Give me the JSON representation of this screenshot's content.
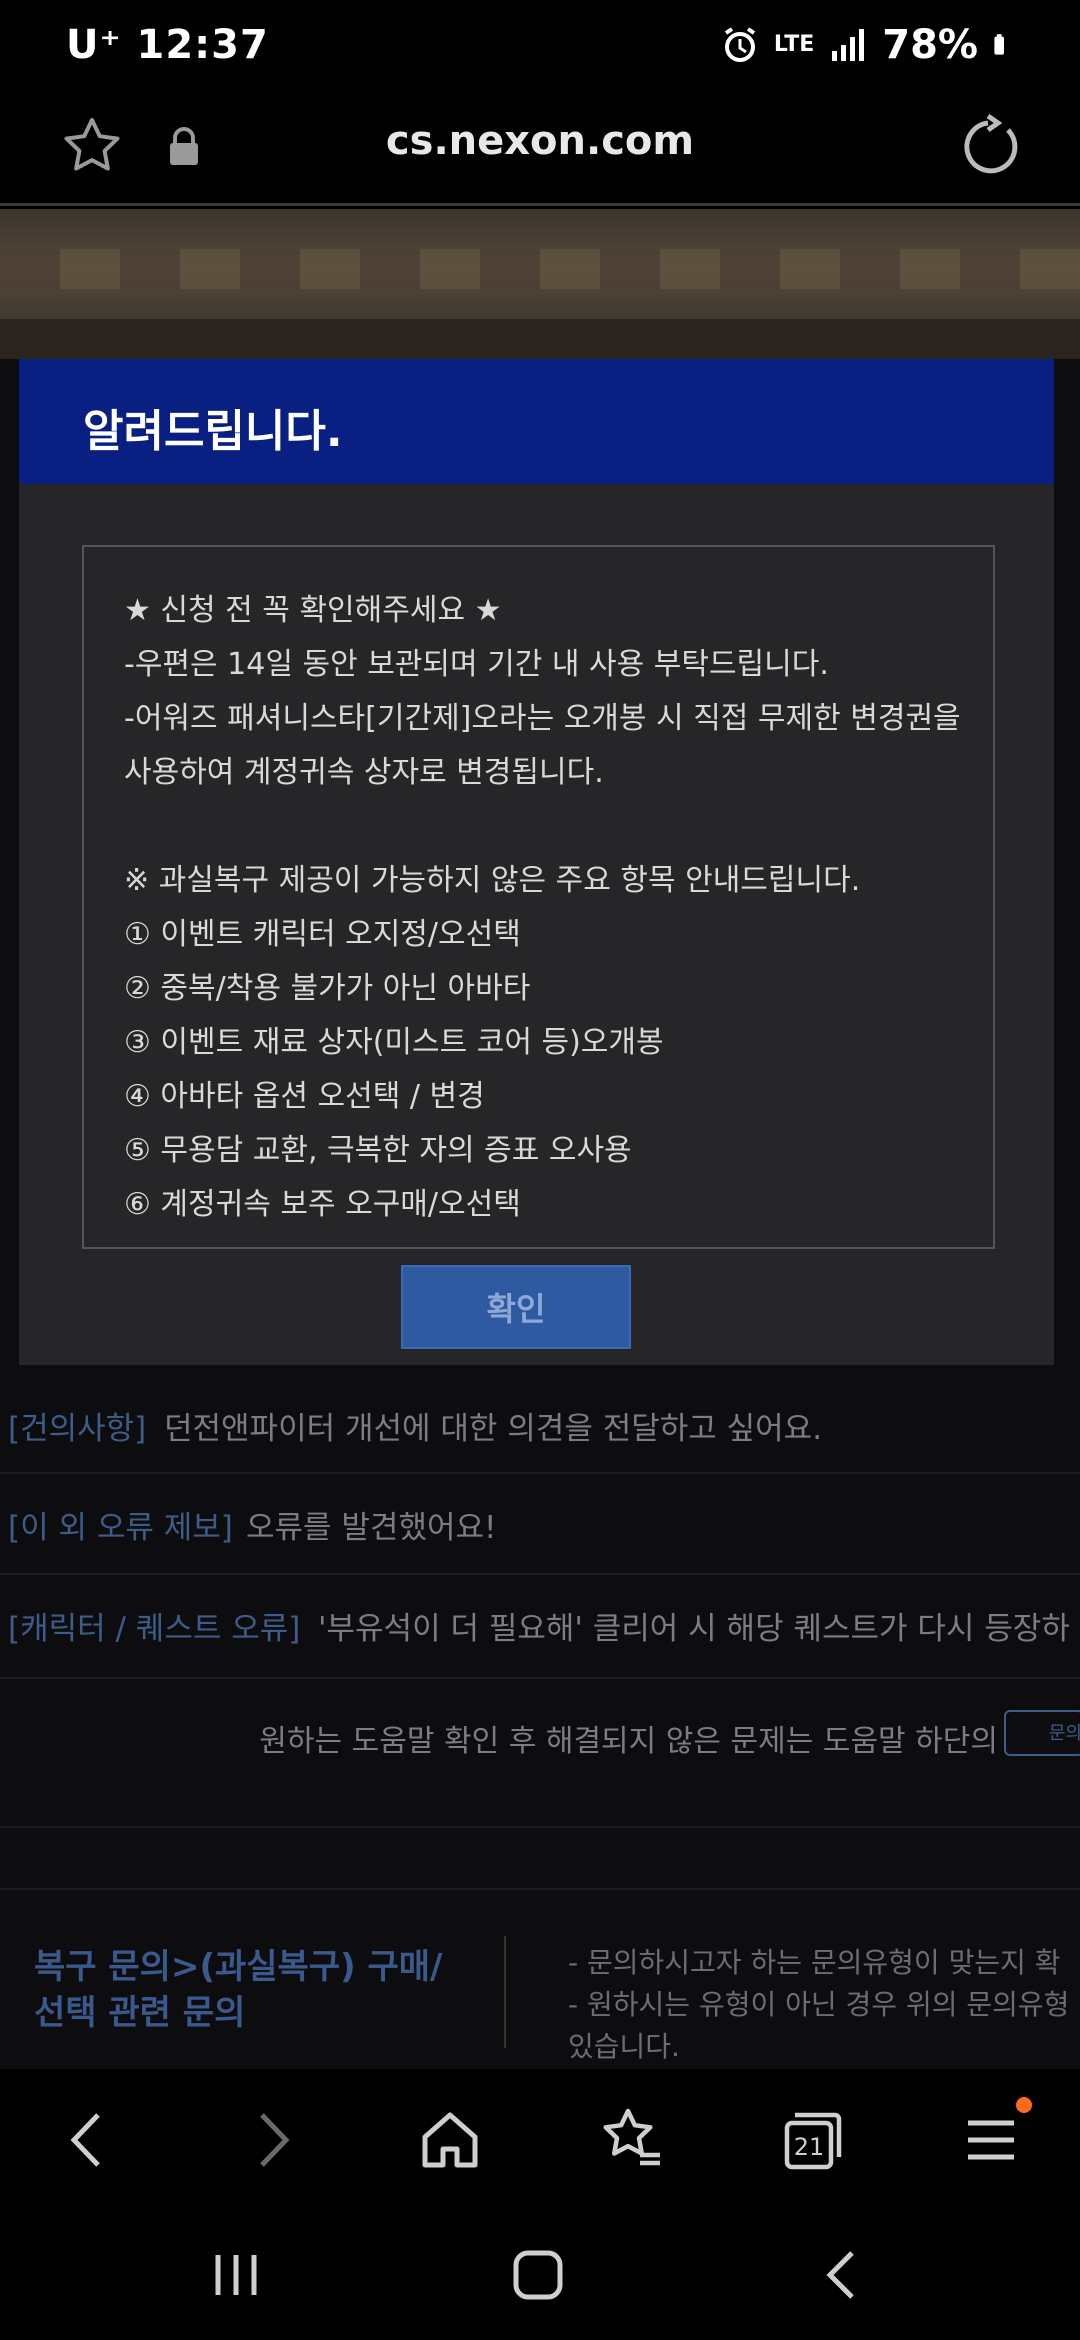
{
  "status_bar": {
    "carrier_time": "U⁺ 12:37",
    "network": "LTE",
    "battery": "78%"
  },
  "browser": {
    "url": "cs.nexon.com"
  },
  "page": {
    "rows": [
      {
        "category": "[건의사항]",
        "text": "던전앤파이터 개선에 대한 의견을 전달하고 싶어요."
      },
      {
        "category": "[이 외 오류 제보]",
        "text": "오류를 발견했어요!"
      },
      {
        "category": "[캐릭터 / 퀘스트 오류]",
        "text": "'부유석이 더 필요해' 클리어 시 해당 퀘스트가 다시 등장하"
      }
    ],
    "help_text": "원하는 도움말 확인 후 해결되지 않은 문제는 도움말 하단의",
    "help_button": "문의",
    "footer_title_line1": "복구 문의>(과실복구) 구매/",
    "footer_title_line2": "선택 관련 문의",
    "footer_notes": [
      "- 문의하시고자 하는 문의유형이 맞는지 확",
      "- 원하시는 유형이 아닌 경우 위의 문의유형",
      "  있습니다."
    ]
  },
  "modal": {
    "title": "알려드립니다.",
    "lines": [
      "★ 신청 전 꼭 확인해주세요 ★",
      "-우편은 14일 동안 보관되며 기간 내 사용 부탁드립니다.",
      "-어워즈 패셔니스타[기간제]오라는 오개봉 시 직접 무제한 변경권을",
      "사용하여 계정귀속 상자로 변경됩니다.",
      "",
      "※ 과실복구 제공이 가능하지 않은 주요 항목 안내드립니다.",
      "① 이벤트 캐릭터 오지정/오선택",
      "② 중복/착용 불가가 아닌 아바타",
      "③ 이벤트 재료 상자(미스트 코어 등)오개봉",
      "④ 아바타 옵션 오선택 / 변경",
      "⑤ 무용담 교환, 극복한 자의 증표 오사용",
      "⑥ 계정귀속 보주 오구매/오선택"
    ],
    "confirm_label": "확인"
  },
  "bottom_nav": {
    "tabs_count": "21"
  },
  "colors": {
    "modal_header": "#0a1f82",
    "confirm_button": "#2d5aa0",
    "badge_dot": "#ff6a1a"
  }
}
